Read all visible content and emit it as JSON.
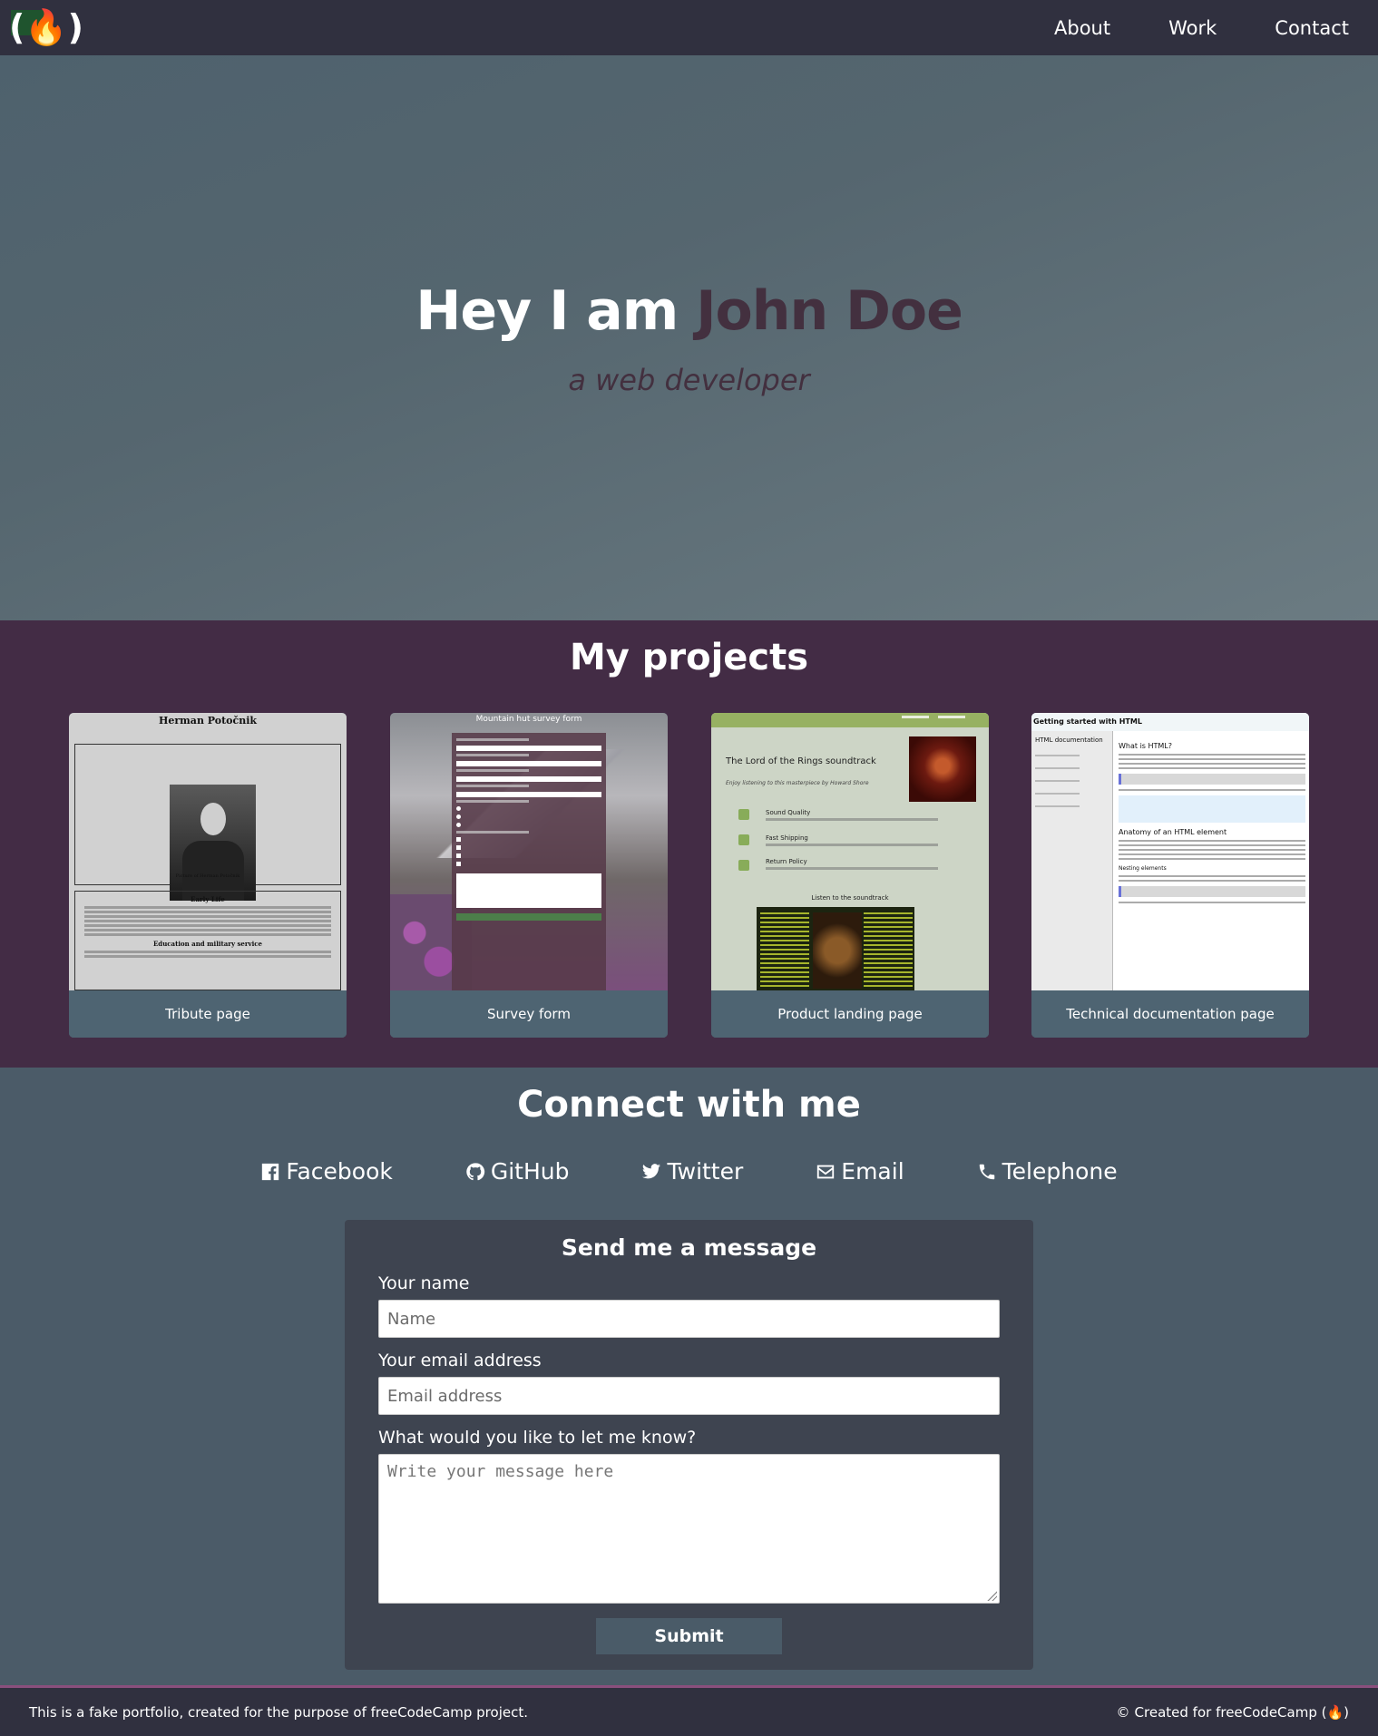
{
  "nav": {
    "logo_text": "(🔥)",
    "links": [
      "About",
      "Work",
      "Contact"
    ]
  },
  "hero": {
    "greeting": "Hey I am",
    "name": "John Doe",
    "subtitle": "a web developer"
  },
  "projects": {
    "title": "My projects",
    "cards": [
      {
        "label": "Tribute page",
        "thumb_title": "Herman Potočnik",
        "thumb_caption": "Picture of Herman Potočnik",
        "thumb_heading1": "Early Life",
        "thumb_heading2": "Education and military service"
      },
      {
        "label": "Survey form",
        "thumb_title": "Mountain hut survey form",
        "thumb_submit": "Submit"
      },
      {
        "label": "Product landing page",
        "thumb_title": "The Lord of the Rings soundtrack",
        "thumb_tagline": "Enjoy listening to this masterpiece by Howard Shore",
        "thumb_features": [
          "Sound Quality",
          "Fast Shipping",
          "Return Policy"
        ],
        "thumb_listen": "Listen to the soundtrack"
      },
      {
        "label": "Technical documentation page",
        "thumb_header": "Getting started with HTML",
        "thumb_nav_title": "HTML documentation",
        "thumb_section1": "What is HTML?",
        "thumb_section2": "Anatomy of an HTML element",
        "thumb_section3": "Nesting elements"
      }
    ]
  },
  "connect": {
    "title": "Connect with me",
    "socials": [
      {
        "label": "Facebook",
        "icon": "facebook-icon"
      },
      {
        "label": "GitHub",
        "icon": "github-icon"
      },
      {
        "label": "Twitter",
        "icon": "twitter-icon"
      },
      {
        "label": "Email",
        "icon": "envelope-icon"
      },
      {
        "label": "Telephone",
        "icon": "phone-icon"
      }
    ],
    "form": {
      "title": "Send me a message",
      "name_label": "Your name",
      "name_placeholder": "Name",
      "email_label": "Your email address",
      "email_placeholder": "Email address",
      "message_label": "What would you like to let me know?",
      "message_placeholder": "Write your message here",
      "submit": "Submit"
    }
  },
  "footer": {
    "left": "This is a fake portfolio, created for the purpose of freeCodeCamp project.",
    "right": "Created for freeCodeCamp (🔥)"
  },
  "colors": {
    "nav_bg": "#30303f",
    "hero_accent": "#43303f",
    "projects_bg": "#432c45",
    "connect_bg": "#4b5b68",
    "form_bg": "#3e4450"
  }
}
